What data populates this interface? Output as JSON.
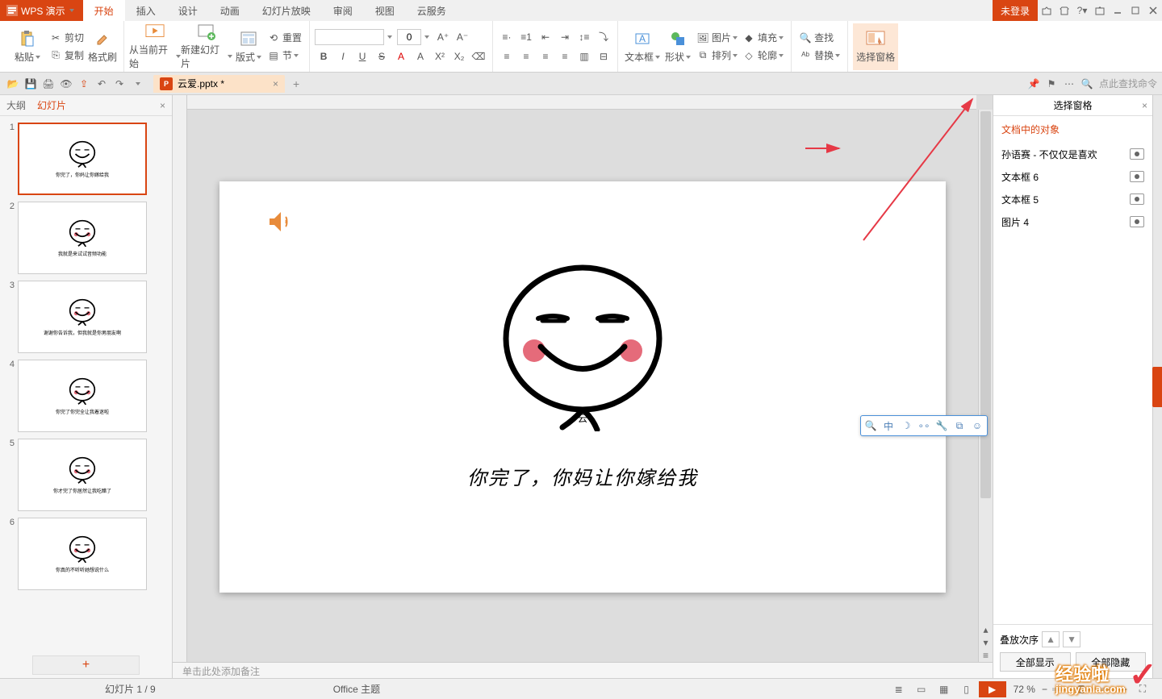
{
  "app": {
    "brand": "WPS 演示",
    "login": "未登录"
  },
  "menuTabs": [
    "开始",
    "插入",
    "设计",
    "动画",
    "幻灯片放映",
    "审阅",
    "视图",
    "云服务"
  ],
  "menuActive": 0,
  "docTab": {
    "name": "云爱.pptx *"
  },
  "ribbon": {
    "paste": "粘贴",
    "cut": "剪切",
    "copy": "复制",
    "format": "格式刷",
    "fromCurrent": "从当前开始",
    "newSlide": "新建幻灯片",
    "layout": "版式",
    "reset": "重置",
    "section": "节",
    "fontName": "",
    "fontSize": "0",
    "textbox": "文本框",
    "shape": "形状",
    "image": "图片",
    "arrange": "排列",
    "fill": "填充",
    "outline": "轮廓",
    "find": "查找",
    "replace": "替换",
    "selectPane": "选择窗格"
  },
  "qab": {
    "searchHint": "点此查找命令"
  },
  "leftPanel": {
    "tab1": "大纲",
    "tab2": "幻灯片",
    "add": "+"
  },
  "thumbs": [
    {
      "n": "1",
      "text": "你完了，你妈让你嫁给我",
      "star": true,
      "blush": false
    },
    {
      "n": "2",
      "text": "我就是来试试音频功能",
      "blush": true
    },
    {
      "n": "3",
      "text": "谢谢你告诉我，但我就是你男朋友啊",
      "blush": true
    },
    {
      "n": "4",
      "text": "你完了你完全让我着迷啦",
      "blush": true
    },
    {
      "n": "5",
      "text": "你才完了你居然让我吃醋了",
      "blush": true
    },
    {
      "n": "6",
      "text": "你真的不听听她想说什么",
      "blush": true
    }
  ],
  "slide": {
    "caption": "你完了，你妈让你嫁给我",
    "yun": "云"
  },
  "notes": "单击此处添加备注",
  "rightPane": {
    "title": "选择窗格",
    "sub": "文档中的对象",
    "items": [
      "孙语赛 - 不仅仅是喜欢",
      "文本框 6",
      "文本框 5",
      "图片 4"
    ],
    "order": "叠放次序",
    "showAll": "全部显示",
    "hideAll": "全部隐藏"
  },
  "status": {
    "slideCount": "幻灯片 1 / 9",
    "theme": "Office 主题",
    "zoom": "72 %"
  },
  "watermark": {
    "line1": "经验啦",
    "line2": "jingyanla.com"
  }
}
